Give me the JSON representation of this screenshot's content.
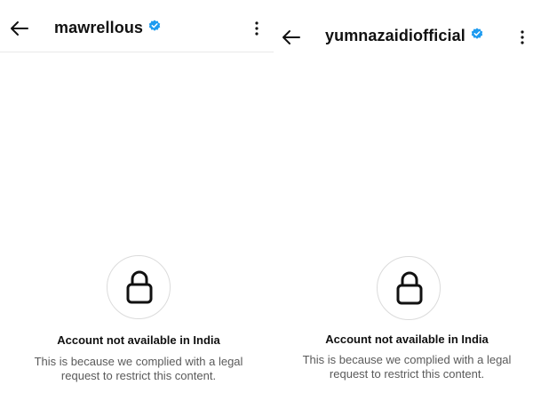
{
  "panels": [
    {
      "username": "mawrellous",
      "verified": true,
      "notice_title": "Account not available in India",
      "notice_body": "This is because we complied with a legal request to restrict this content."
    },
    {
      "username": "yumnazaidiofficial",
      "verified": true,
      "notice_title": "Account not available in India",
      "notice_body": "This is because we complied with a legal request to restrict this content."
    }
  ],
  "icons": {
    "back": "back-arrow-icon",
    "verified": "verified-badge-icon",
    "more": "more-options-icon",
    "lock": "lock-icon"
  },
  "colors": {
    "verified_blue": "#1d9bf0",
    "text_primary": "#111111",
    "text_secondary": "#5a5a5a",
    "border": "#dbdbdb"
  }
}
